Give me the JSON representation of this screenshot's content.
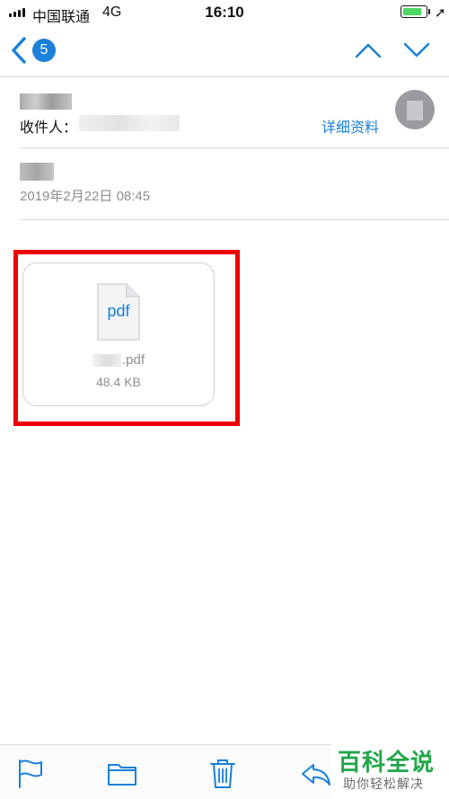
{
  "status_bar": {
    "carrier": "中国联通",
    "network": "4G",
    "time": "16:10",
    "battery_percent": 85,
    "battery_color": "#4cd964"
  },
  "nav": {
    "back_icon": "chevron-left-icon",
    "unread_badge": "5",
    "prev_icon": "chevron-up-icon",
    "next_icon": "chevron-down-icon",
    "accent_color": "#1a80d9"
  },
  "email": {
    "recipient_label": "收件人：",
    "details_link": "详细资料",
    "date": "2019年2月22日 08:45"
  },
  "attachment": {
    "icon_label": "pdf",
    "file_extension": ".pdf",
    "file_size": "48.4 KB",
    "highlight_color": "#ef0000"
  },
  "toolbar": {
    "icons": [
      "flag-icon",
      "folder-icon",
      "trash-icon",
      "reply-icon"
    ]
  },
  "watermark": {
    "title": "百科全说",
    "subtitle": "助你轻松解决",
    "color": "#22a64a"
  }
}
